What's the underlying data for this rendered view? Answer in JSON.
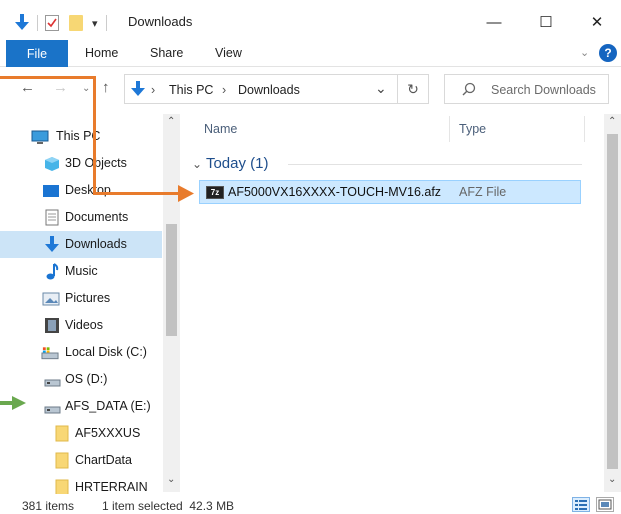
{
  "window": {
    "title": "Downloads",
    "minimize_glyph": "—",
    "maximize_glyph": "☐",
    "close_glyph": "✕"
  },
  "quick_access": {
    "menu_glyph": "▾"
  },
  "ribbon": {
    "tabs": [
      "File",
      "Home",
      "Share",
      "View"
    ],
    "help_glyph": "?",
    "chevron_glyph": "⌄"
  },
  "address": {
    "crumbs": [
      "This PC",
      "Downloads"
    ],
    "separator": "›",
    "dropdown_glyph": "⌄",
    "refresh_glyph": "↻"
  },
  "search": {
    "placeholder": "Search Downloads"
  },
  "nav_pane": {
    "items": [
      {
        "label": "This PC",
        "icon": "this-pc-icon"
      },
      {
        "label": "3D Objects",
        "icon": "3d-objects-icon"
      },
      {
        "label": "Desktop",
        "icon": "desktop-icon"
      },
      {
        "label": "Documents",
        "icon": "documents-icon"
      },
      {
        "label": "Downloads",
        "icon": "downloads-icon",
        "selected": true
      },
      {
        "label": "Music",
        "icon": "music-icon"
      },
      {
        "label": "Pictures",
        "icon": "pictures-icon"
      },
      {
        "label": "Videos",
        "icon": "videos-icon"
      },
      {
        "label": "Local Disk (C:)",
        "icon": "local-disk-icon"
      },
      {
        "label": "OS (D:)",
        "icon": "drive-icon"
      },
      {
        "label": "AFS_DATA (E:)",
        "icon": "drive-icon"
      },
      {
        "label": "AF5XXXUS",
        "icon": "folder-icon"
      },
      {
        "label": "ChartData",
        "icon": "folder-icon"
      },
      {
        "label": "HRTERRAIN",
        "icon": "folder-icon"
      }
    ]
  },
  "content": {
    "columns": [
      "Name",
      "Type"
    ],
    "group_label": "Today (1)",
    "files": [
      {
        "name": "AF5000VX16XXXX-TOUCH-MV16.afz",
        "type": "AFZ File",
        "icon_text": "7z"
      }
    ]
  },
  "status": {
    "item_count": "381 items",
    "selection": "1 item selected  42.3 MB"
  },
  "colors": {
    "accent": "#1a73c8",
    "annotation_orange": "#e87b2c",
    "annotation_green": "#6aa84f",
    "selection": "#cce8ff"
  }
}
